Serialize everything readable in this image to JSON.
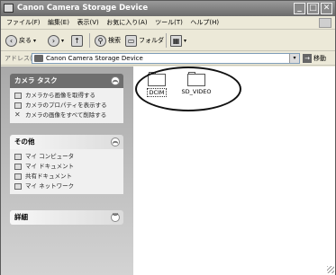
{
  "window": {
    "title": "Canon Camera Storage Device",
    "minimize": "_",
    "maximize": "□",
    "close": "✕"
  },
  "menu": [
    "ファイル(F)",
    "編集(E)",
    "表示(V)",
    "お気に入り(A)",
    "ツール(T)",
    "ヘルプ(H)"
  ],
  "toolbar": {
    "back_label": "戻る",
    "search_label": "検索",
    "folders_label": "フォルダ"
  },
  "address": {
    "label": "アドレス(D)",
    "value": "Canon Camera Storage Device",
    "go_label": "移動"
  },
  "taskpane": {
    "camera_tasks": {
      "title": "カメラ タスク",
      "items": [
        "カメラから画像を取得する",
        "カメラのプロパティを表示する",
        "カメラの画像をすべて削除する"
      ]
    },
    "other": {
      "title": "その他",
      "items": [
        "マイ コンピュータ",
        "マイ ドキュメント",
        "共有ドキュメント",
        "マイ ネットワーク"
      ]
    },
    "details": {
      "title": "詳細"
    }
  },
  "files": [
    {
      "name": "DCIM",
      "icon": "folder-icon"
    },
    {
      "name": "SD_VIDEO",
      "icon": "folder-icon"
    }
  ]
}
